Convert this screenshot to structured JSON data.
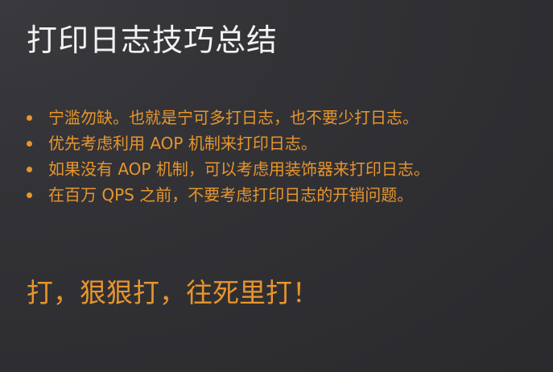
{
  "slide": {
    "title": "打印日志技巧总结",
    "bullets": [
      "宁滥勿缺。也就是宁可多打日志，也不要少打日志。",
      "优先考虑利用 AOP 机制来打印日志。",
      "如果没有 AOP 机制，可以考虑用装饰器来打印日志。",
      "在百万 QPS 之前，不要考虑打印日志的开销问题。"
    ],
    "tagline": "打，狠狠打，往死里打！"
  },
  "colors": {
    "background": "#333337",
    "title": "#f2f2f2",
    "accent": "#e8952d"
  }
}
